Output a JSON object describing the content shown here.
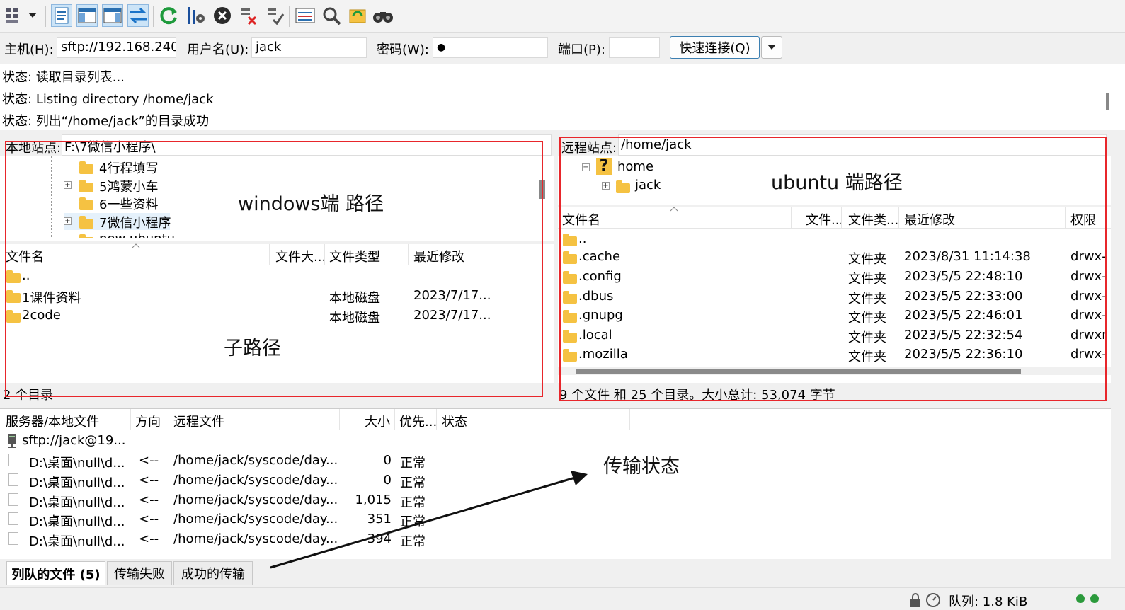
{
  "toolbar": {
    "icons": [
      "site-manager-icon",
      "dropdown-arrow-icon",
      "toggle-log-icon",
      "toggle-local-tree-icon",
      "toggle-remote-tree-icon",
      "toggle-queue-icon",
      "refresh-icon",
      "process-queue-icon",
      "cancel-icon",
      "disconnect-icon",
      "reconnect-icon",
      "filter-icon",
      "toggle-compare-icon",
      "sync-browse-icon",
      "search-binoculars-icon"
    ]
  },
  "quickconnect": {
    "host_label": "主机(H):",
    "host_value": "sftp://192.168.240.",
    "user_label": "用户名(U):",
    "user_value": "jack",
    "pass_label": "密码(W):",
    "pass_value": "●",
    "port_label": "端口(P):",
    "port_value": "",
    "connect_label": "快速连接(Q)"
  },
  "log": [
    {
      "prefix": "状态:",
      "text": "读取目录列表..."
    },
    {
      "prefix": "状态:",
      "text": "Listing directory /home/jack"
    },
    {
      "prefix": "状态:",
      "text": "列出“/home/jack”的目录成功"
    }
  ],
  "local": {
    "site_label": "本地站点:",
    "path": "F:\\7微信小程序\\",
    "tree": [
      {
        "label": "4行程填写",
        "expander": false
      },
      {
        "label": "5鸿蒙小车",
        "expander": true
      },
      {
        "label": "6一些资料",
        "expander": false
      },
      {
        "label": "7微信小程序",
        "expander": true
      },
      {
        "label": "new ubuntu",
        "expander": false
      }
    ],
    "columns": [
      "文件名",
      "文件大...",
      "文件类型",
      "最近修改"
    ],
    "rows": [
      {
        "name": "..",
        "size": "",
        "type": "",
        "modified": ""
      },
      {
        "name": "1课件资料",
        "size": "",
        "type": "本地磁盘",
        "modified": "2023/7/17..."
      },
      {
        "name": "2code",
        "size": "",
        "type": "本地磁盘",
        "modified": "2023/7/17..."
      }
    ],
    "status": "2 个目录"
  },
  "remote": {
    "site_label": "远程站点:",
    "path": "/home/jack",
    "tree": [
      {
        "label": "home",
        "icon": "?"
      },
      {
        "label": "jack",
        "icon": "folder"
      }
    ],
    "columns": [
      "文件名",
      "文件...",
      "文件类...",
      "最近修改",
      "权限"
    ],
    "rows": [
      {
        "name": "..",
        "type": "",
        "modified": "",
        "perm": ""
      },
      {
        "name": ".cache",
        "type": "文件夹",
        "modified": "2023/8/31 11:14:38",
        "perm": "drwx-"
      },
      {
        "name": ".config",
        "type": "文件夹",
        "modified": "2023/5/5 22:48:10",
        "perm": "drwx-"
      },
      {
        "name": ".dbus",
        "type": "文件夹",
        "modified": "2023/5/5 22:33:00",
        "perm": "drwx-"
      },
      {
        "name": ".gnupg",
        "type": "文件夹",
        "modified": "2023/5/5 22:46:01",
        "perm": "drwx-"
      },
      {
        "name": ".local",
        "type": "文件夹",
        "modified": "2023/5/5 22:32:54",
        "perm": "drwxr"
      },
      {
        "name": ".mozilla",
        "type": "文件夹",
        "modified": "2023/5/5 22:36:10",
        "perm": "drwx-"
      }
    ],
    "status": "9 个文件 和 25 个目录。大小总计: 53,074 字节"
  },
  "queue": {
    "columns": [
      "服务器/本地文件",
      "方向",
      "远程文件",
      "大小",
      "优先...",
      "状态"
    ],
    "server": "sftp://jack@19...",
    "rows": [
      {
        "local": "D:\\桌面\\null\\d...",
        "dir": "<--",
        "remote": "/home/jack/syscode/day...",
        "size": "0",
        "priority": "正常"
      },
      {
        "local": "D:\\桌面\\null\\d...",
        "dir": "<--",
        "remote": "/home/jack/syscode/day...",
        "size": "0",
        "priority": "正常"
      },
      {
        "local": "D:\\桌面\\null\\d...",
        "dir": "<--",
        "remote": "/home/jack/syscode/day...",
        "size": "1,015",
        "priority": "正常"
      },
      {
        "local": "D:\\桌面\\null\\d...",
        "dir": "<--",
        "remote": "/home/jack/syscode/day...",
        "size": "351",
        "priority": "正常"
      },
      {
        "local": "D:\\桌面\\null\\d...",
        "dir": "<--",
        "remote": "/home/jack/syscode/day...",
        "size": "394",
        "priority": "正常"
      }
    ],
    "tabs": [
      "列队的文件 (5)",
      "传输失败",
      "成功的传输"
    ]
  },
  "statusbar": {
    "queue_text": "队列: 1.8 KiB"
  },
  "annotations": {
    "windows": "windows端 路径",
    "ubuntu": "ubuntu 端路径",
    "subpath": "子路径",
    "transfer": "传输状态"
  },
  "colors": {
    "annotation_box": "#e8262b",
    "folder": "#f5c242",
    "accent": "#3c7fb1"
  }
}
